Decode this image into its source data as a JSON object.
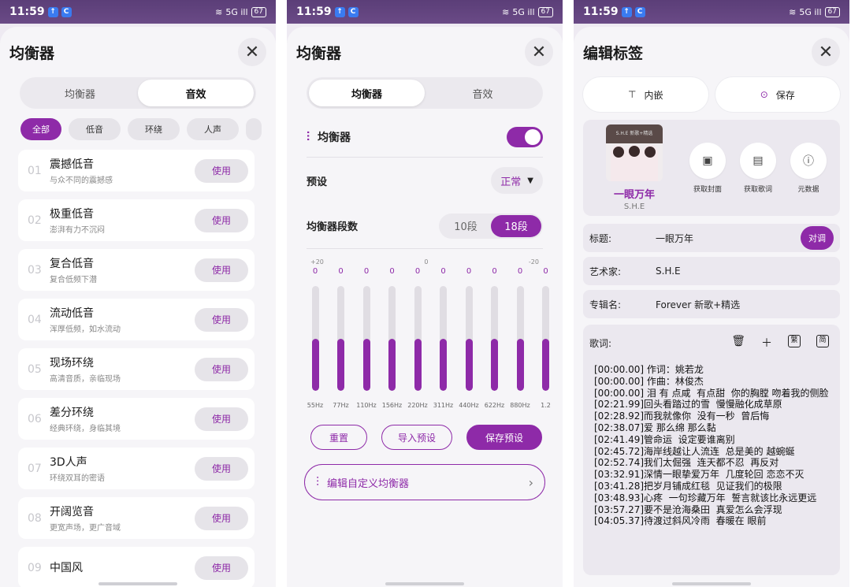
{
  "status_bar": {
    "time": "11:59",
    "signal": "5G ill",
    "battery": "67"
  },
  "colors": {
    "accent": "#8e2aa8",
    "page_bg": "#f6f5f8",
    "status_bg": "#5b3e78"
  },
  "panel1": {
    "title": "均衡器",
    "tabs": [
      "均衡器",
      "音效"
    ],
    "active_tab": "音效",
    "chips": [
      "全部",
      "低音",
      "环绕",
      "人声"
    ],
    "items": [
      {
        "num": "01",
        "title": "震撼低音",
        "sub": "与众不同的震撼感",
        "action": "使用"
      },
      {
        "num": "02",
        "title": "极重低音",
        "sub": "澎湃有力不沉闷",
        "action": "使用"
      },
      {
        "num": "03",
        "title": "复合低音",
        "sub": "复合低频下潜",
        "action": "使用"
      },
      {
        "num": "04",
        "title": "流动低音",
        "sub": "浑厚低频，如水流动",
        "action": "使用"
      },
      {
        "num": "05",
        "title": "现场环绕",
        "sub": "高清音质，亲临现场",
        "action": "使用"
      },
      {
        "num": "06",
        "title": "差分环绕",
        "sub": "经典环绕，身临其境",
        "action": "使用"
      },
      {
        "num": "07",
        "title": "3D人声",
        "sub": "环绕双耳的密语",
        "action": "使用"
      },
      {
        "num": "08",
        "title": "开阔览音",
        "sub": "更宽声场，更广音域",
        "action": "使用"
      },
      {
        "num": "09",
        "title": "中国风",
        "sub": "",
        "action": "使用"
      }
    ]
  },
  "panel2": {
    "title": "均衡器",
    "tabs": [
      "均衡器",
      "音效"
    ],
    "active_tab": "均衡器",
    "eq_label": "均衡器",
    "eq_enabled": true,
    "preset_label": "预设",
    "preset_value": "正常",
    "bands_label": "均衡器段数",
    "band_options": [
      "10段",
      "18段"
    ],
    "band_active": "18段",
    "scale": [
      "+20",
      "0",
      "-20"
    ],
    "bands": [
      {
        "freq": "55Hz",
        "value": "0",
        "level": 0.5
      },
      {
        "freq": "77Hz",
        "value": "0",
        "level": 0.5
      },
      {
        "freq": "110Hz",
        "value": "0",
        "level": 0.5
      },
      {
        "freq": "156Hz",
        "value": "0",
        "level": 0.5
      },
      {
        "freq": "220Hz",
        "value": "0",
        "level": 0.5
      },
      {
        "freq": "311Hz",
        "value": "0",
        "level": 0.5
      },
      {
        "freq": "440Hz",
        "value": "0",
        "level": 0.5
      },
      {
        "freq": "622Hz",
        "value": "0",
        "level": 0.5
      },
      {
        "freq": "880Hz",
        "value": "0",
        "level": 0.5
      },
      {
        "freq": "1.2",
        "value": "0",
        "level": 0.5
      }
    ],
    "buttons": [
      "重置",
      "导入预设",
      "保存预设"
    ],
    "edit_custom": "编辑自定义均衡器"
  },
  "panel3": {
    "title": "编辑标签",
    "embed_label": "内嵌",
    "save_label": "保存",
    "cover_text": "S.H.E 新歌+精选",
    "song_title": "一眼万年",
    "song_artist": "S.H.E",
    "tools": [
      "获取封面",
      "获取歌词",
      "元数据"
    ],
    "fields": [
      {
        "key": "标题:",
        "value": "一眼万年",
        "action": "对调"
      },
      {
        "key": "艺术家:",
        "value": "S.H.E"
      },
      {
        "key": "专辑名:",
        "value": "Forever 新歌+精选"
      }
    ],
    "lyrics_label": "歌词:",
    "lyrics_tool_trad": "繁",
    "lyrics_tool_simp": "简",
    "lyrics": "[00:00.00] 作词：姚若龙\n[00:00.00] 作曲：林俊杰\n[00:00.00] 泪 有 点咸  有点甜  你的胸膛 吻着我的侧脸\n[02:21.99]回头看踏过的雪  慢慢融化成草原\n[02:28.92]而我就像你  没有一秒  曾后悔\n[02:38.07]爱 那么绵 那么黏\n[02:41.49]管命运  设定要谁离别\n[02:45.72]海岸线越让人流连  总是美的 越蜿蜒\n[02:52.74]我们太倔强  连天都不忍  再反对\n[03:32.91]深情一眼挚爱万年  几度轮回 恋恋不灭\n[03:41.28]把岁月铺成红毯  见证我们的极限\n[03:48.93]心疼  一句珍藏万年  誓言就该比永远更远\n[03:57.27]要不是沧海桑田  真爱怎么会浮现\n[04:05.37]待渡过斜风冷雨  春暖在 眼前"
  }
}
